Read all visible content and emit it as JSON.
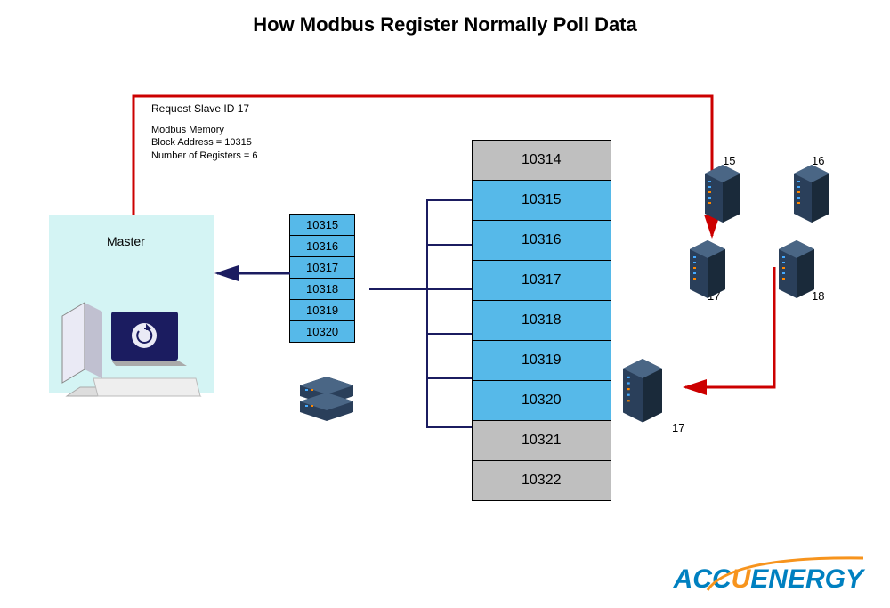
{
  "title": "How Modbus Register Normally Poll Data",
  "request_label": "Request Slave ID 17",
  "memory_block": {
    "line1": "Modbus Memory",
    "line2": "Block Address = 10315",
    "line3": "Number of Registers = 6"
  },
  "master_label": "Master",
  "response_registers": [
    "10315",
    "10316",
    "10317",
    "10318",
    "10319",
    "10320"
  ],
  "memory_registers": [
    {
      "addr": "10314",
      "cls": "reg-gray"
    },
    {
      "addr": "10315",
      "cls": "reg-blue"
    },
    {
      "addr": "10316",
      "cls": "reg-blue"
    },
    {
      "addr": "10317",
      "cls": "reg-blue"
    },
    {
      "addr": "10318",
      "cls": "reg-blue"
    },
    {
      "addr": "10319",
      "cls": "reg-blue"
    },
    {
      "addr": "10320",
      "cls": "reg-blue"
    },
    {
      "addr": "10321",
      "cls": "reg-gray"
    },
    {
      "addr": "10322",
      "cls": "reg-gray"
    }
  ],
  "servers": {
    "top_left": "15",
    "top_right": "16",
    "mid_left": "17",
    "mid_right": "18",
    "bottom": "17"
  },
  "logo_parts": {
    "p1": "ACC",
    "p2": "U",
    "p3": "ENERGY"
  }
}
